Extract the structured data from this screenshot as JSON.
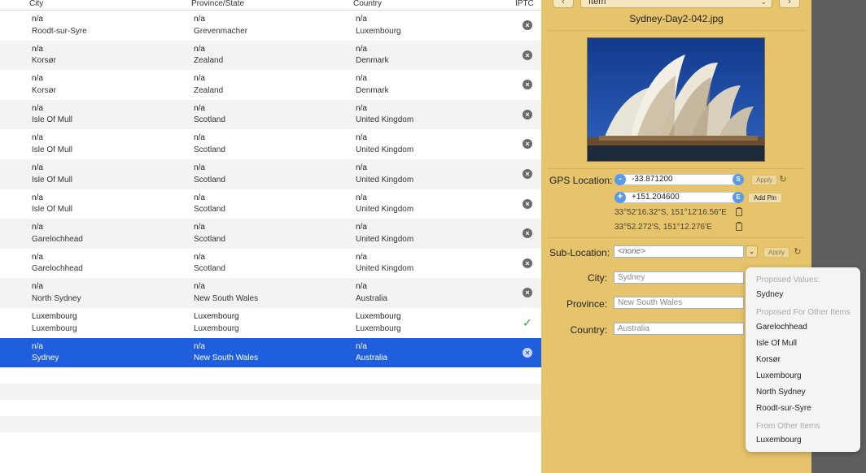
{
  "table": {
    "headers": {
      "city": "City",
      "province": "Province/State",
      "country": "Country",
      "iptc": "IPTC"
    },
    "rows": [
      {
        "v1": [
          "n/a",
          "n/a",
          "n/a"
        ],
        "v2": [
          "Roodt-sur-Syre",
          "Grevenmacher",
          "Luxembourg"
        ],
        "status": "x"
      },
      {
        "v1": [
          "n/a",
          "n/a",
          "n/a"
        ],
        "v2": [
          "Korsør",
          "Zealand",
          "Denmark"
        ],
        "status": "x"
      },
      {
        "v1": [
          "n/a",
          "n/a",
          "n/a"
        ],
        "v2": [
          "Korsør",
          "Zealand",
          "Denmark"
        ],
        "status": "x"
      },
      {
        "v1": [
          "n/a",
          "n/a",
          "n/a"
        ],
        "v2": [
          "Isle Of Mull",
          "Scotland",
          "United Kingdom"
        ],
        "status": "x"
      },
      {
        "v1": [
          "n/a",
          "n/a",
          "n/a"
        ],
        "v2": [
          "Isle Of Mull",
          "Scotland",
          "United Kingdom"
        ],
        "status": "x"
      },
      {
        "v1": [
          "n/a",
          "n/a",
          "n/a"
        ],
        "v2": [
          "Isle Of Mull",
          "Scotland",
          "United Kingdom"
        ],
        "status": "x"
      },
      {
        "v1": [
          "n/a",
          "n/a",
          "n/a"
        ],
        "v2": [
          "Isle Of Mull",
          "Scotland",
          "United Kingdom"
        ],
        "status": "x"
      },
      {
        "v1": [
          "n/a",
          "n/a",
          "n/a"
        ],
        "v2": [
          "Garelochhead",
          "Scotland",
          "United Kingdom"
        ],
        "status": "x"
      },
      {
        "v1": [
          "n/a",
          "n/a",
          "n/a"
        ],
        "v2": [
          "Garelochhead",
          "Scotland",
          "United Kingdom"
        ],
        "status": "x"
      },
      {
        "v1": [
          "n/a",
          "n/a",
          "n/a"
        ],
        "v2": [
          "North Sydney",
          "New South Wales",
          "Australia"
        ],
        "status": "x"
      },
      {
        "v1": [
          "Luxembourg",
          "Luxembourg",
          "Luxembourg"
        ],
        "v2": [
          "Luxembourg",
          "Luxembourg",
          "Luxembourg"
        ],
        "status": "check"
      },
      {
        "v1": [
          "n/a",
          "n/a",
          "n/a"
        ],
        "v2": [
          "Sydney",
          "New South Wales",
          "Australia"
        ],
        "status": "x",
        "selected": true
      }
    ]
  },
  "panel": {
    "nav_prev": "‹",
    "nav_next": "›",
    "item_popup": "Item",
    "filename": "Sydney-Day2-042.jpg",
    "gps": {
      "label": "GPS Location:",
      "lat_value": "-33.871200",
      "lon_value": "+151.204600",
      "lat_sign_btn": "-",
      "lon_sign_btn": "+",
      "lat_hemi": "S",
      "lon_hemi": "E",
      "apply": "Apply",
      "add_pin": "Add Pin",
      "dms": "33°52'16.32\"S, 151°12'16.56\"E",
      "decimal_minutes": "33°52.272'S, 151°12.276'E"
    },
    "sublocation": {
      "label": "Sub-Location:",
      "placeholder": "<none>",
      "apply": "Apply"
    },
    "city": {
      "label": "City:",
      "placeholder": "Sydney"
    },
    "province": {
      "label": "Province:",
      "placeholder": "New South Wales"
    },
    "country": {
      "label": "Country:",
      "placeholder": "Australia"
    }
  },
  "popup": {
    "h1": "Proposed Values:",
    "i1": "Sydney",
    "h2": "Proposed For Other Items",
    "items2": [
      "Garelochhead",
      "Isle Of Mull",
      "Korsør",
      "Luxembourg",
      "North Sydney",
      "Roodt-sur-Syre"
    ],
    "h3": "From Other Items",
    "i3": "Luxembourg"
  },
  "icons": {
    "clear": "x-circle-icon",
    "valid": "checkmark-icon",
    "refresh": "refresh-icon",
    "copy": "clipboard-icon"
  },
  "colors": {
    "selection": "#1f5fde",
    "panel": "#e6c46c",
    "accent": "#5a9ae8",
    "check": "#2fa82f"
  }
}
